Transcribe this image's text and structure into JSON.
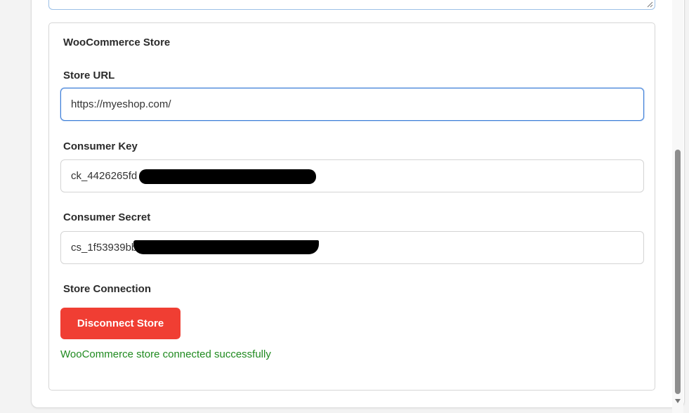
{
  "store_section": {
    "title": "WooCommerce Store",
    "store_url": {
      "label": "Store URL",
      "value": "https://myeshop.com/"
    },
    "consumer_key": {
      "label": "Consumer Key",
      "value": "ck_4426265fd"
    },
    "consumer_secret": {
      "label": "Consumer Secret",
      "value": "cs_1f53939bb"
    },
    "connection": {
      "label": "Store Connection",
      "button_label": "Disconnect Store",
      "status_message": "WooCommerce store connected successfully"
    }
  },
  "colors": {
    "danger_button": "#f03e33",
    "success_text": "#1f8a1f",
    "focus_border": "#3b7dd8"
  },
  "icons": {
    "resize_grip": "resize-grip-icon",
    "scroll_down": "chevron-down-icon"
  }
}
